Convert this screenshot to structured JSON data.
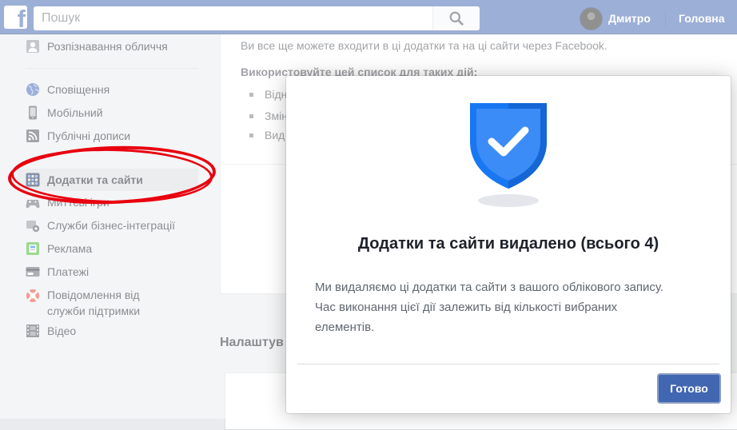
{
  "header": {
    "search_placeholder": "Пошук",
    "user_name": "Дмитро",
    "home_label": "Головна"
  },
  "sidebar": {
    "items": [
      {
        "label": "Розпізнавання обличчя",
        "icon": "face-recognition-icon"
      },
      {
        "label": "Сповіщення",
        "icon": "globe-icon"
      },
      {
        "label": "Мобільний",
        "icon": "mobile-phone-icon"
      },
      {
        "label": "Публічні дописи",
        "icon": "rss-feed-icon"
      },
      {
        "label": "Додатки та сайти",
        "icon": "apps-icon"
      },
      {
        "label": "Миттєві ігри",
        "icon": "instant-games-icon"
      },
      {
        "label": "Служби бізнес-інтеграції",
        "icon": "business-integrations-icon"
      },
      {
        "label": "Реклама",
        "icon": "ads-icon"
      },
      {
        "label": "Платежі",
        "icon": "credit-card-icon"
      },
      {
        "label_line1": "Повідомлення від",
        "label_line2": "служби підтримки",
        "icon": "lifebuoy-icon"
      },
      {
        "label": "Відео",
        "icon": "film-strip-icon"
      }
    ]
  },
  "main": {
    "intro_text": "Ви все ще можете входити в ці додатки та на ці сайти через Facebook.",
    "list_heading": "Використовуйте цей список для таких дій:",
    "bullets": [
      "Відн",
      "Змін",
      "Вид"
    ],
    "section_heading": "Налаштув"
  },
  "dialog": {
    "title": "Додатки та сайти видалено (всього 4)",
    "body_line1": "Ми видаляємо ці додатки та сайти з вашого облікового запису.",
    "body_line2": "Час виконання цієї дії залежить від кількості вибраних",
    "body_line3": "елементів.",
    "done_label": "Готово"
  },
  "colors": {
    "brand": "#4267b2",
    "annotation": "#e8000e",
    "shield": "#1877f2"
  }
}
